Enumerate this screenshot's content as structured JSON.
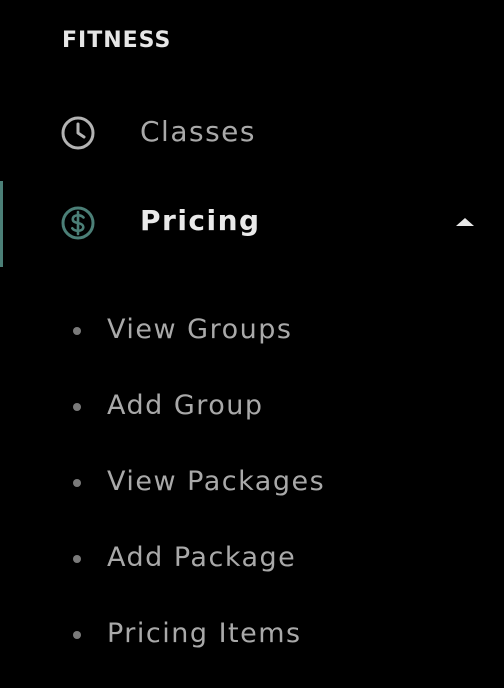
{
  "section": {
    "title": "FITNESS"
  },
  "nav": {
    "classes": {
      "label": "Classes",
      "icon": "clock-icon"
    },
    "pricing": {
      "label": "Pricing",
      "icon": "dollar-circle-icon",
      "expanded": true,
      "accent_color": "#4b7f77",
      "submenu": [
        {
          "label": "View Groups"
        },
        {
          "label": "Add Group"
        },
        {
          "label": "View Packages"
        },
        {
          "label": "Add Package"
        },
        {
          "label": "Pricing Items"
        }
      ]
    }
  },
  "colors": {
    "background": "#000000",
    "text_primary": "#e9e9e9",
    "text_secondary": "#a9a9a9",
    "accent": "#4b7f77"
  }
}
